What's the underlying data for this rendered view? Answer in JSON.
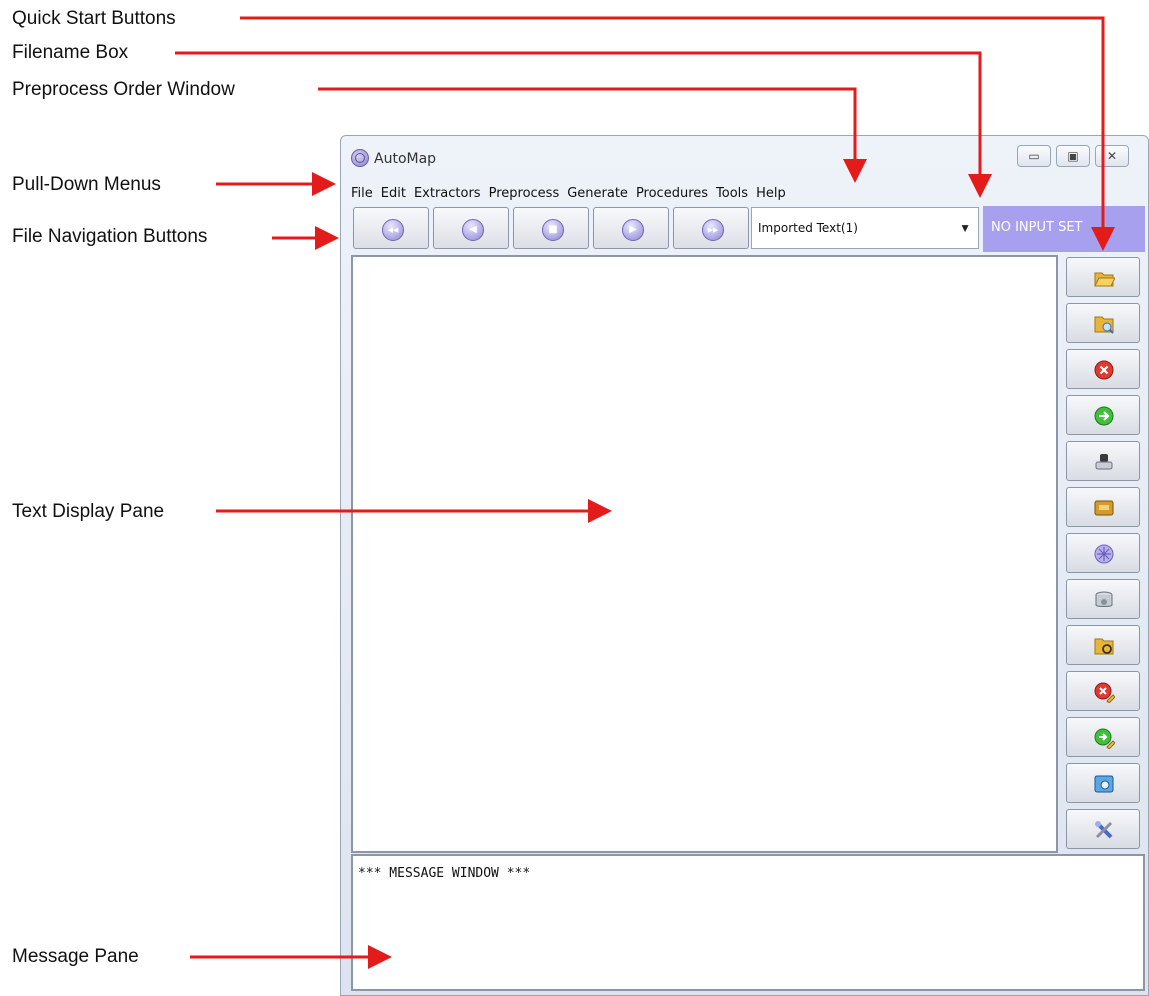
{
  "annotations": {
    "quick_start": "Quick Start Buttons",
    "filename_box": "Filename Box",
    "preprocess_order": "Preprocess Order Window",
    "pulldown": "Pull-Down Menus",
    "file_nav": "File Navigation Buttons",
    "text_display": "Text Display Pane",
    "message_pane": "Message Pane"
  },
  "window": {
    "title": "AutoMap",
    "controls": {
      "minimize": "▭",
      "maximize": "▣",
      "close": "✕"
    }
  },
  "menu": [
    "File",
    "Edit",
    "Extractors",
    "Preprocess",
    "Generate",
    "Procedures",
    "Tools",
    "Help"
  ],
  "nav_buttons": [
    {
      "icon": "rewind-icon",
      "glyph": "◀◀"
    },
    {
      "icon": "previous-icon",
      "glyph": "◀"
    },
    {
      "icon": "stop-icon",
      "glyph": "■"
    },
    {
      "icon": "next-icon",
      "glyph": "▶"
    },
    {
      "icon": "fast-forward-icon",
      "glyph": "▶▶"
    }
  ],
  "preprocess_combo": {
    "value": "Imported Text(1)",
    "arrow": "▼"
  },
  "filename_box": {
    "text": "NO INPUT SET",
    "color": "#a7a0ee"
  },
  "quick_start_buttons": [
    "open-folder-icon",
    "folder-search-icon",
    "remove-red-icon",
    "go-green-icon",
    "stamp-icon",
    "panel-icon",
    "automap-icon",
    "database-icon",
    "folder-refresh-icon",
    "remove-edit-icon",
    "go-edit-icon",
    "preview-icon",
    "tools-icon"
  ],
  "message_pane": {
    "text": "*** MESSAGE WINDOW ***"
  }
}
